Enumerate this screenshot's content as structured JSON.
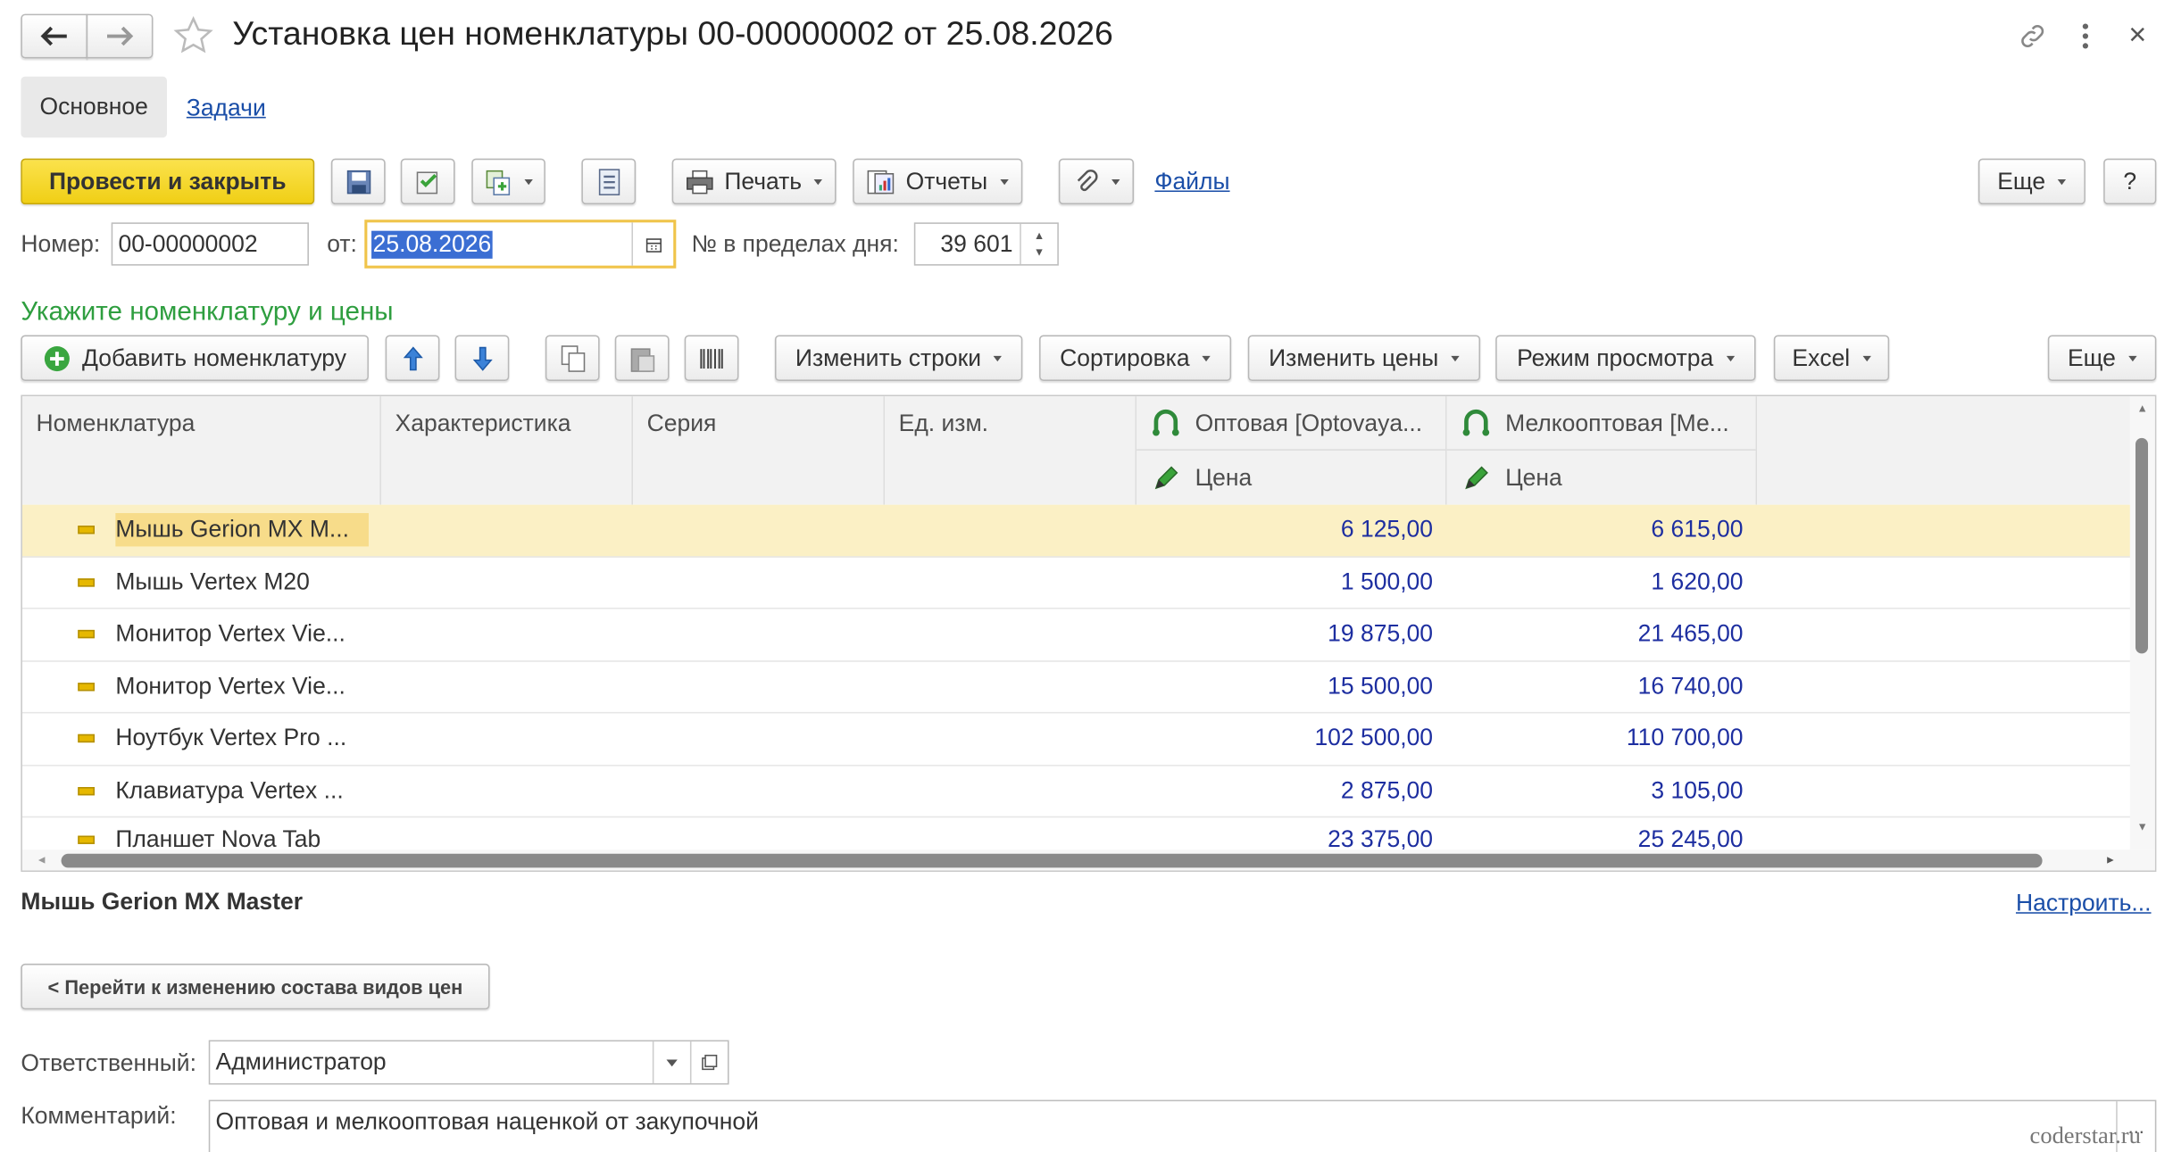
{
  "window": {
    "title": "Установка цен номенклатуры 00-00000002 от 25.08.2026",
    "nav_back_icon": "arrow-left-icon",
    "nav_forward_icon": "arrow-right-icon",
    "favorite_icon": "star-icon"
  },
  "tabs": [
    {
      "label": "Основное",
      "active": true
    },
    {
      "label": "Задачи",
      "active": false
    }
  ],
  "toolbar": {
    "post_close": "Провести и закрыть",
    "print": "Печать",
    "reports": "Отчеты",
    "files": "Файлы",
    "more": "Еще",
    "help": "?"
  },
  "header_fields": {
    "number_label": "Номер:",
    "number_value": "00-00000002",
    "date_label": "от:",
    "date_value": "25.08.2026",
    "day_num_label": "№ в пределах дня:",
    "day_num_value": "39 601"
  },
  "section_title": "Укажите номенклатуру и цены",
  "table_toolbar": {
    "add": "Добавить номенклатуру",
    "change_rows": "Изменить строки",
    "sort": "Сортировка",
    "change_prices": "Изменить цены",
    "view_mode": "Режим просмотра",
    "excel": "Excel",
    "more": "Еще"
  },
  "table": {
    "columns": [
      "Номенклатура",
      "Характеристика",
      "Серия",
      "Ед. изм.",
      "Оптовая [Optovaya...",
      "Мелкооптовая [Ме..."
    ],
    "subheader": [
      "Цена",
      "Цена"
    ],
    "rows": [
      {
        "name": "Мышь Gerion MX M...",
        "wholesale": "6 125,00",
        "small": "6 615,00",
        "selected": true
      },
      {
        "name": "Мышь Vertex M20",
        "wholesale": "1 500,00",
        "small": "1 620,00"
      },
      {
        "name": "Монитор Vertex Vie...",
        "wholesale": "19 875,00",
        "small": "21 465,00"
      },
      {
        "name": "Монитор Vertex Vie...",
        "wholesale": "15 500,00",
        "small": "16 740,00"
      },
      {
        "name": "Ноутбук Vertex Pro ...",
        "wholesale": "102 500,00",
        "small": "110 700,00"
      },
      {
        "name": "Клавиатура Vertex ...",
        "wholesale": "2 875,00",
        "small": "3 105,00"
      },
      {
        "name": "Планшет Nova Tab",
        "wholesale": "23 375,00",
        "small": "25 245,00"
      }
    ]
  },
  "selected_item": "Мышь Gerion MX Master",
  "configure_link": "Настроить...",
  "go_button": "< Перейти к изменению состава видов цен",
  "responsible": {
    "label": "Ответственный:",
    "value": "Администратор"
  },
  "comment": {
    "label": "Комментарий:",
    "value": "Оптовая и мелкооптовая наценкой от закупочной"
  },
  "watermark": "coderstar.ru",
  "colors": {
    "accent_yellow": "#f5d833",
    "selected_row": "#fbf0c5",
    "section_green": "#2e9e3f",
    "link": "#1a4ea8",
    "price_blue": "#1d2ea0"
  }
}
